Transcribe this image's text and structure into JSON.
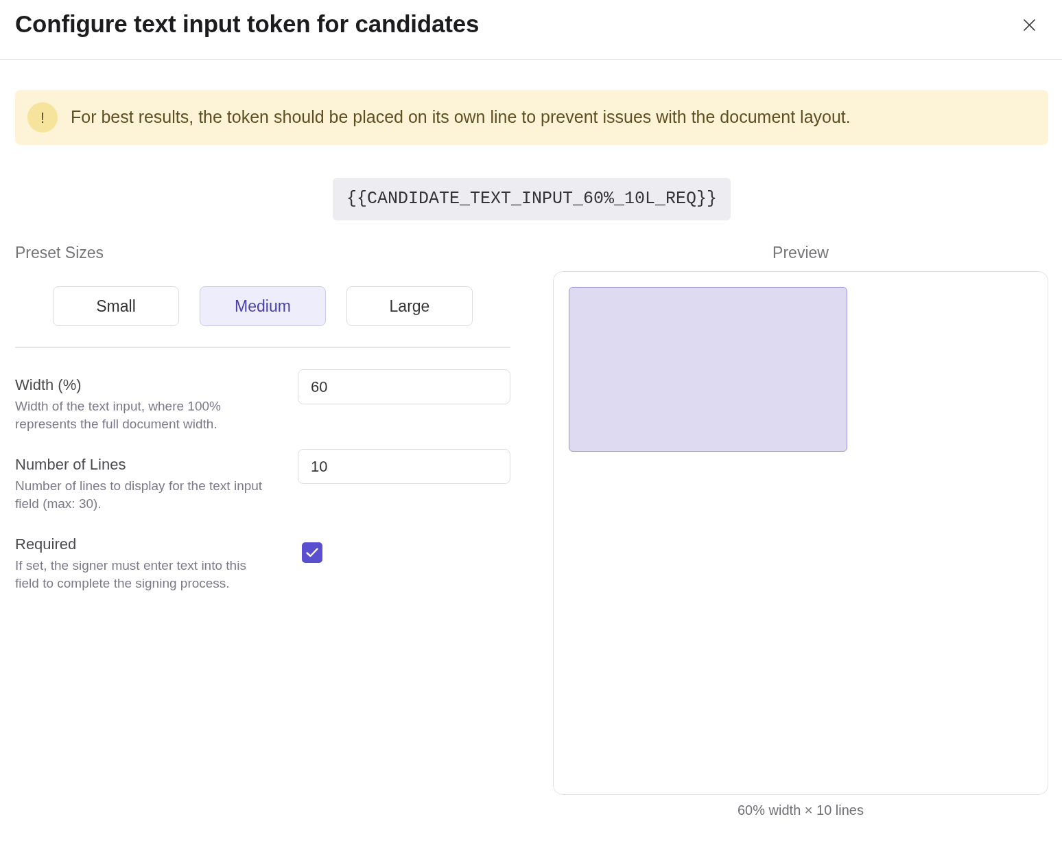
{
  "dialog": {
    "title": "Configure text input token for candidates"
  },
  "alert": {
    "icon": "!",
    "text": "For best results, the token should be placed on its own line to prevent issues with the document layout."
  },
  "token": "{{CANDIDATE_TEXT_INPUT_60%_10L_REQ}}",
  "presets": {
    "label": "Preset Sizes",
    "options": [
      {
        "label": "Small",
        "selected": false
      },
      {
        "label": "Medium",
        "selected": true
      },
      {
        "label": "Large",
        "selected": false
      }
    ]
  },
  "fields": [
    {
      "kind": "number",
      "label": "Width (%)",
      "description": "Width of the text input, where 100% represents the full document width.",
      "value": "60"
    },
    {
      "kind": "number",
      "label": "Number of Lines",
      "description": "Number of lines to display for the text input field (max: 30).",
      "value": "10"
    },
    {
      "kind": "checkbox",
      "label": "Required",
      "description": "If set, the signer must enter text into this field to complete the signing process.",
      "checked": true
    }
  ],
  "preview": {
    "label": "Preview",
    "caption": "60% width × 10 lines"
  }
}
